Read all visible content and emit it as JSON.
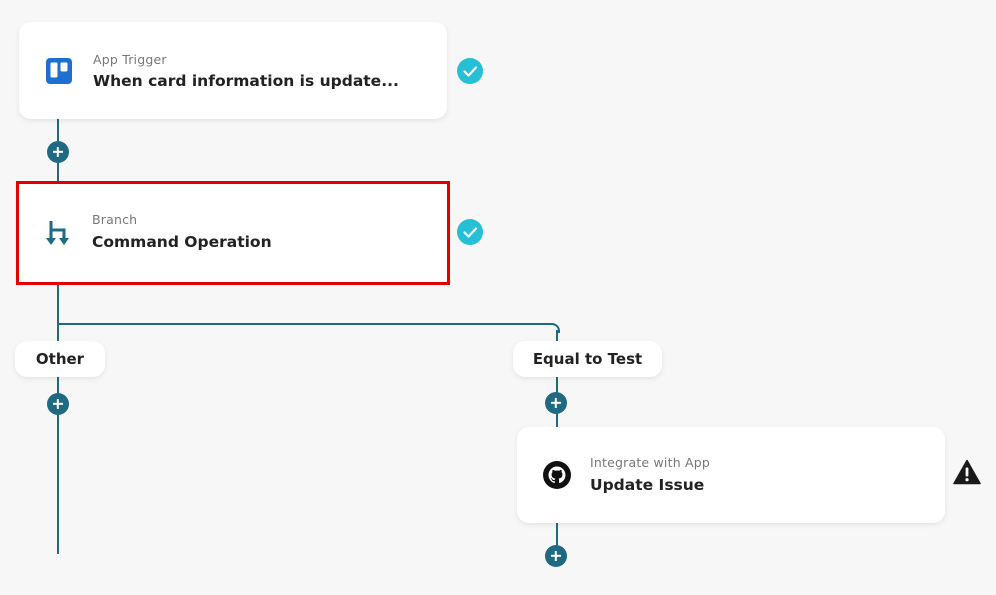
{
  "trigger": {
    "kicker": "App Trigger",
    "title": "When card information is update...",
    "icon": "trello-icon",
    "status": "check-icon"
  },
  "branch": {
    "kicker": "Branch",
    "title": "Command Operation",
    "icon": "branch-icon",
    "status": "check-icon"
  },
  "paths": {
    "other_label": "Other",
    "equal_label": "Equal to Test"
  },
  "action": {
    "kicker": "Integrate with App",
    "title": "Update Issue",
    "icon": "github-icon",
    "status": "warning-icon"
  },
  "colors": {
    "connector": "#1f6a82",
    "check": "#25bfd6",
    "highlight": "#e30000",
    "trello": "#1f6fd1"
  }
}
